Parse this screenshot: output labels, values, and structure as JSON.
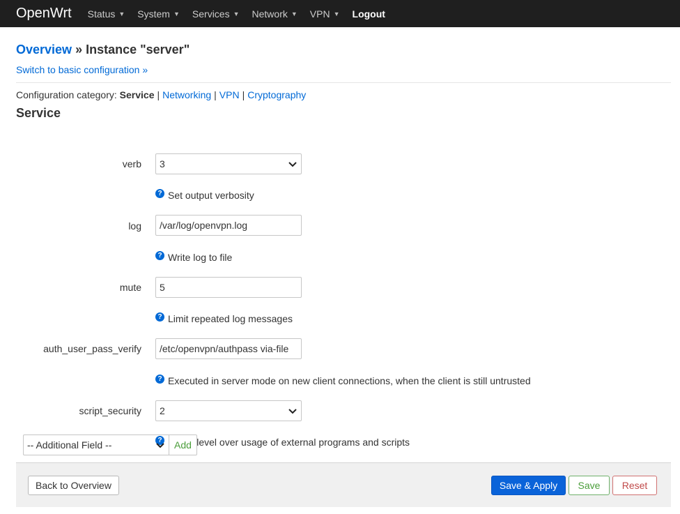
{
  "nav": {
    "brand": "OpenWrt",
    "items": [
      {
        "label": "Status"
      },
      {
        "label": "System"
      },
      {
        "label": "Services"
      },
      {
        "label": "Network"
      },
      {
        "label": "VPN"
      }
    ],
    "logout": "Logout"
  },
  "header": {
    "overview_link": "Overview",
    "title_rest": " » Instance \"server\"",
    "switch_link": "Switch to basic configuration »"
  },
  "category": {
    "prefix": "Configuration category:",
    "active": "Service",
    "links": [
      "Networking",
      "VPN",
      "Cryptography"
    ],
    "separator": "|"
  },
  "section_title": "Service",
  "fields": [
    {
      "label": "verb",
      "value": "3",
      "help": "Set output verbosity"
    },
    {
      "label": "log",
      "value": "/var/log/openvpn.log",
      "help": "Write log to file"
    },
    {
      "label": "mute",
      "value": "5",
      "help": "Limit repeated log messages"
    },
    {
      "label": "auth_user_pass_verify",
      "value": "/etc/openvpn/authpass via-file",
      "help": "Executed in server mode on new client connections, when the client is still untrusted"
    },
    {
      "label": "script_security",
      "value": "2",
      "help": "Policy level over usage of external programs and scripts"
    }
  ],
  "help_icon_glyph": "?",
  "additional": {
    "select_value": "-- Additional Field --",
    "add_label": "Add"
  },
  "footer": {
    "back": "Back to Overview",
    "save_apply": "Save & Apply",
    "save": "Save",
    "reset": "Reset"
  },
  "colors": {
    "navbar": "#1f1f1f",
    "link": "#0069d6",
    "primary": "#0a63d9",
    "save": "#4a9d3a",
    "reset": "#c04a4a"
  }
}
